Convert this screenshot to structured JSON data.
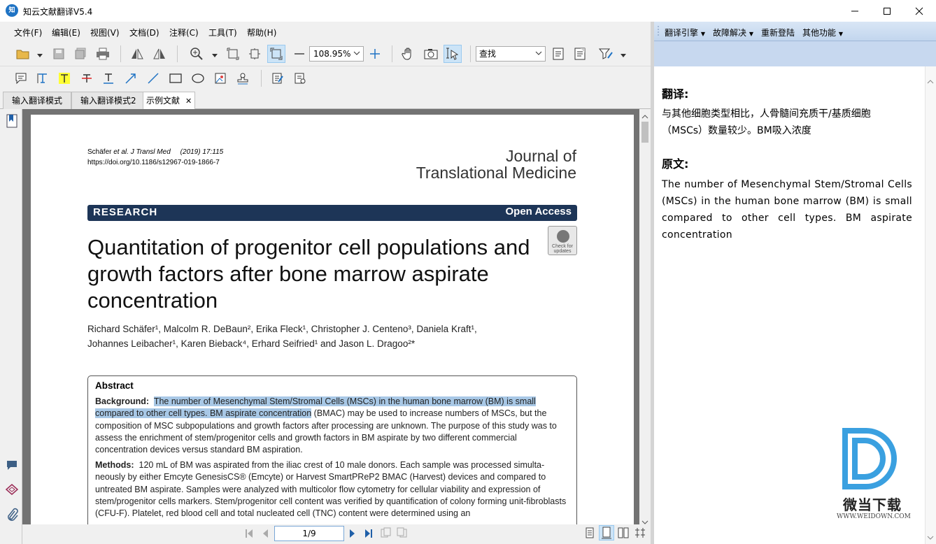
{
  "window": {
    "title": "知云文献翻译V5.4",
    "app_icon_text": "知"
  },
  "menu": [
    "文件(F)",
    "编辑(E)",
    "视图(V)",
    "文档(D)",
    "注释(C)",
    "工具(T)",
    "帮助(H)"
  ],
  "toolbar": {
    "zoom": "108.95%",
    "find": "查找"
  },
  "tabs": [
    {
      "label": "输入翻译模式"
    },
    {
      "label": "输入翻译模式2"
    },
    {
      "label": "示例文献",
      "active": true
    }
  ],
  "document": {
    "citation_line1_author": "Schäfer ",
    "citation_line1_journal": "et al. J Transl Med",
    "citation_line1_year": "(2019) 17:115",
    "citation_line2": "https://doi.org/10.1186/s12967-019-1866-7",
    "journal_line1": "Journal of",
    "journal_line2": "Translational Medicine",
    "banner_left": "RESEARCH",
    "banner_right": "Open Access",
    "badge_text": "Check for updates",
    "title": "Quantitation of progenitor cell populations and growth factors after bone marrow aspirate concentration",
    "authors_line1": "Richard Schäfer¹, Malcolm R. DeBaun², Erika Fleck¹, Christopher J. Centeno³, Daniela Kraft¹,",
    "authors_line2": "Johannes Leibacher¹, Karen Bieback⁴, Erhard Seifried¹ and Jason L. Dragoo²*",
    "abstract_heading": "Abstract",
    "background_label": "Background:",
    "background_highlight": "The number of Mesenchymal Stem/Stromal Cells (MSCs) in the human bone marrow (BM) is small compared to other cell types. BM aspirate concentration",
    "background_rest": " (BMAC) may be used to increase numbers of MSCs, but the composition of MSC subpopulations and growth factors after processing are unknown. The purpose of this study was to assess the enrichment of stem/progenitor cells and growth factors in BM aspirate by two different commercial concentration devices versus standard BM aspiration.",
    "methods_label": "Methods:",
    "methods_text": "120 mL of BM was aspirated from the iliac crest of 10 male donors. Each sample was processed simulta-neously by either Emcyte GenesisCS® (Emcyte) or Harvest SmartPReP2 BMAC (Harvest) devices and compared to untreated BM aspirate. Samples were analyzed with multicolor flow cytometry for cellular viability and expression of stem/progenitor cells markers. Stem/progenitor cell content was verified by quantification of colony forming unit-fibroblasts (CFU-F). Platelet, red blood cell and total nucleated cell (TNC) content were determined using an"
  },
  "status": {
    "page": "1/9"
  },
  "right_pane": {
    "menu": [
      "翻译引擎",
      "故障解决",
      "重新登陆",
      "其他功能"
    ],
    "translation_heading": "翻译:",
    "translation_line1": "与其他细胞类型相比，人骨髓间充质干/基质细胞",
    "translation_line2": "（MSCs）数量较少。BM吸入浓度",
    "source_heading": "原文:",
    "source_text": "The number of Mesenchymal Stem/Stromal Cells (MSCs) in the human bone marrow (BM) is small compared to other cell types. BM aspirate concentration"
  },
  "watermark": {
    "brand": "微当下载",
    "url": "WWW.WEIDOWN.COM"
  },
  "colors": {
    "highlight": "#a8c8e6",
    "banner": "#1d3557",
    "accent": "#1f73c4"
  }
}
